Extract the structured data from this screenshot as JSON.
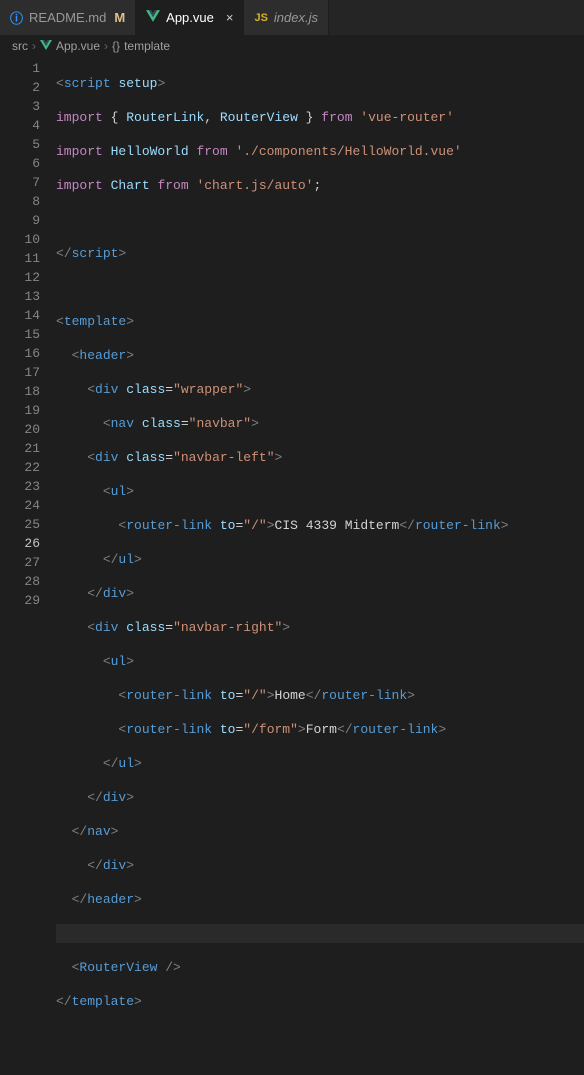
{
  "tabs": [
    {
      "icon": "info-icon",
      "name": "README.md",
      "modified": "M",
      "active": false,
      "italic": false
    },
    {
      "icon": "vue-icon",
      "name": "App.vue",
      "modified": "",
      "active": true,
      "italic": false
    },
    {
      "icon": "js-icon",
      "name": "index.js",
      "modified": "",
      "active": false,
      "italic": true
    }
  ],
  "breadcrumb": {
    "seg0": "src",
    "seg1": "App.vue",
    "seg2": "template",
    "brace": "{}"
  },
  "code": {
    "l1": {
      "a": "<",
      "b": "script",
      "c": " ",
      "d": "setup",
      "e": ">"
    },
    "l2": {
      "a": "import",
      "b": "{ ",
      "c": "RouterLink",
      "d": ", ",
      "e": "RouterView",
      "f": " }",
      "g": " from ",
      "h": "'vue-router'"
    },
    "l3": {
      "a": "import",
      "b": " ",
      "c": "HelloWorld",
      "d": " from ",
      "e": "'./components/HelloWorld.vue'"
    },
    "l4": {
      "a": "import",
      "b": " ",
      "c": "Chart",
      "d": " from ",
      "e": "'chart.js/auto'",
      "f": ";"
    },
    "l6": {
      "a": "</",
      "b": "script",
      "c": ">"
    },
    "l8": {
      "a": "<",
      "b": "template",
      "c": ">"
    },
    "l9": {
      "a": "<",
      "b": "header",
      "c": ">"
    },
    "l10": {
      "a": "<",
      "b": "div",
      "c": " ",
      "d": "class",
      "e": "=",
      "f": "\"wrapper\"",
      "g": ">"
    },
    "l11": {
      "a": "<",
      "b": "nav",
      "c": " ",
      "d": "class",
      "e": "=",
      "f": "\"navbar\"",
      "g": ">"
    },
    "l12": {
      "a": "<",
      "b": "div",
      "c": " ",
      "d": "class",
      "e": "=",
      "f": "\"navbar-left\"",
      "g": ">"
    },
    "l13": {
      "a": "<",
      "b": "ul",
      "c": ">"
    },
    "l14": {
      "a": "<",
      "b": "router-link",
      "c": " ",
      "d": "to",
      "e": "=",
      "f": "\"/\"",
      "g": ">",
      "h": "CIS 4339 Midterm",
      "i": "</",
      "j": "router-link",
      "k": ">"
    },
    "l15": {
      "a": "</",
      "b": "ul",
      "c": ">"
    },
    "l16": {
      "a": "</",
      "b": "div",
      "c": ">"
    },
    "l17": {
      "a": "<",
      "b": "div",
      "c": " ",
      "d": "class",
      "e": "=",
      "f": "\"navbar-right\"",
      "g": ">"
    },
    "l18": {
      "a": "<",
      "b": "ul",
      "c": ">"
    },
    "l19": {
      "a": "<",
      "b": "router-link",
      "c": " ",
      "d": "to",
      "e": "=",
      "f": "\"/\"",
      "g": ">",
      "h": "Home",
      "i": "</",
      "j": "router-link",
      "k": ">"
    },
    "l20": {
      "a": "<",
      "b": "router-link",
      "c": " ",
      "d": "to",
      "e": "=",
      "f": "\"/form\"",
      "g": ">",
      "h": "Form",
      "i": "</",
      "j": "router-link",
      "k": ">"
    },
    "l21": {
      "a": "</",
      "b": "ul",
      "c": ">"
    },
    "l22": {
      "a": "</",
      "b": "div",
      "c": ">"
    },
    "l23": {
      "a": "</",
      "b": "nav",
      "c": ">"
    },
    "l24": {
      "a": "</",
      "b": "div",
      "c": ">"
    },
    "l25": {
      "a": "</",
      "b": "header",
      "c": ">"
    },
    "l27": {
      "a": "<",
      "b": "RouterView",
      "c": " />"
    },
    "l28": {
      "a": "</",
      "b": "template",
      "c": ">"
    }
  },
  "lines": [
    "1",
    "2",
    "3",
    "4",
    "5",
    "6",
    "7",
    "8",
    "9",
    "10",
    "11",
    "12",
    "13",
    "14",
    "15",
    "16",
    "17",
    "18",
    "19",
    "20",
    "21",
    "22",
    "23",
    "24",
    "25",
    "26",
    "27",
    "28",
    "29"
  ],
  "currentLine": "26"
}
